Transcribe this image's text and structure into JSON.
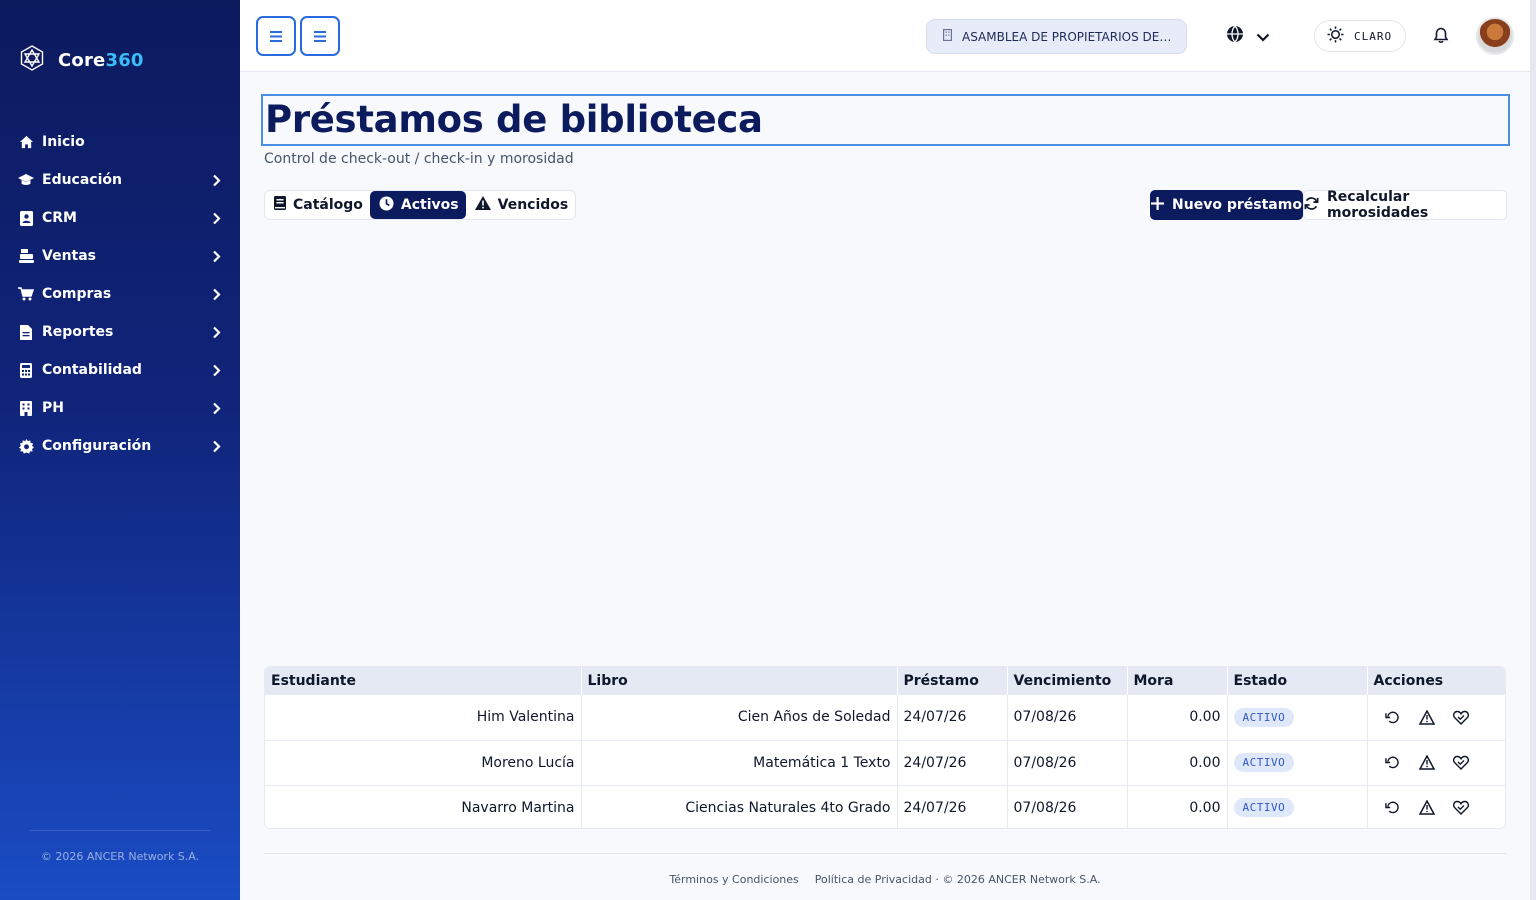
{
  "brand": {
    "name_part1": "Core",
    "name_part2": "360"
  },
  "sidebar": {
    "items": [
      {
        "label": "Inicio",
        "icon": "home-icon"
      },
      {
        "label": "Educación",
        "icon": "graduation-cap-icon"
      },
      {
        "label": "CRM",
        "icon": "contact-card-icon"
      },
      {
        "label": "Ventas",
        "icon": "cash-register-icon"
      },
      {
        "label": "Compras",
        "icon": "shopping-cart-icon"
      },
      {
        "label": "Reportes",
        "icon": "file-report-icon"
      },
      {
        "label": "Contabilidad",
        "icon": "calculator-icon"
      },
      {
        "label": "PH",
        "icon": "building-icon"
      },
      {
        "label": "Configuración",
        "icon": "gear-icon"
      }
    ],
    "footer": "© 2026 ANCER Network S.A."
  },
  "topbar": {
    "organization": "ASAMBLEA DE PROPIETARIOS DE …",
    "theme_label": "CLARO"
  },
  "page": {
    "title": "Préstamos de biblioteca",
    "subtitle": "Control de check-out / check-in y morosidad"
  },
  "tabs": [
    {
      "label": "Catálogo",
      "icon": "book-icon",
      "active": false
    },
    {
      "label": "Activos",
      "icon": "clock-icon",
      "active": true
    },
    {
      "label": "Vencidos",
      "icon": "warning-icon",
      "active": false
    }
  ],
  "buttons": {
    "new_loan": "Nuevo préstamo",
    "recalc": "Recalcular morosidades"
  },
  "table": {
    "columns": [
      "Estudiante",
      "Libro",
      "Préstamo",
      "Vencimiento",
      "Mora",
      "Estado",
      "Acciones"
    ],
    "rows": [
      {
        "student": "Him Valentina",
        "book": "Cien Años de Soledad",
        "loan": "24/07/26",
        "due": "07/08/26",
        "fine": "0.00",
        "status": "ACTIVO"
      },
      {
        "student": "Moreno Lucía",
        "book": "Matemática 1 Texto",
        "loan": "24/07/26",
        "due": "07/08/26",
        "fine": "0.00",
        "status": "ACTIVO"
      },
      {
        "student": "Navarro Martina",
        "book": "Ciencias Naturales 4to Grado",
        "loan": "24/07/26",
        "due": "07/08/26",
        "fine": "0.00",
        "status": "ACTIVO"
      }
    ]
  },
  "footer": {
    "terms": "Términos y Condiciones",
    "privacy": "Política de Privacidad",
    "copyright": "· © 2026 ANCER Network S.A."
  },
  "colors": {
    "primary": "#0c1a5e",
    "accent": "#2a6be0",
    "brand_accent": "#38bdf8",
    "badge_bg": "#dfe8fb",
    "badge_text": "#3058c8"
  }
}
